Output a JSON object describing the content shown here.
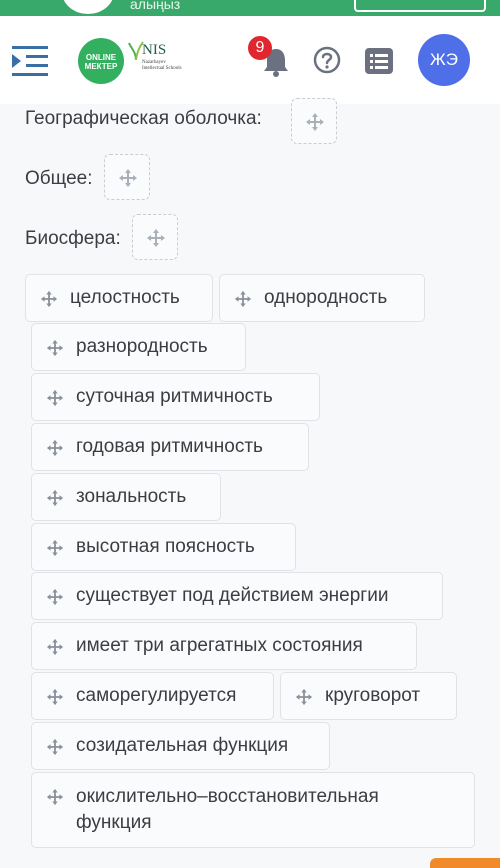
{
  "top_strip": {
    "text": "алыңыз"
  },
  "header": {
    "logo_online_text": "ONLINE\nМЕКТЕР",
    "logo_nis_text": "NIS",
    "logo_nis_sub": "Nazarbayev Intellectual Schools",
    "notification_count": "9",
    "avatar_initials": "ЖЭ"
  },
  "targets": [
    {
      "label": "Географическая оболочка:"
    },
    {
      "label": "Общее:"
    },
    {
      "label": "Биосфера:"
    }
  ],
  "options": [
    {
      "label": "целостность"
    },
    {
      "label": "однородность"
    },
    {
      "label": "разнородность"
    },
    {
      "label": "суточная ритмичность"
    },
    {
      "label": "годовая ритмичность"
    },
    {
      "label": "зональность"
    },
    {
      "label": "высотная поясность"
    },
    {
      "label": "существует под действием энергии"
    },
    {
      "label": "имеет три агрегатных состояния"
    },
    {
      "label": "саморегулируется"
    },
    {
      "label": "круговорот"
    },
    {
      "label": "созидательная функция"
    },
    {
      "label": "окислительно–восстановительная функция"
    }
  ],
  "colors": {
    "brand_green": "#33b05f",
    "avatar_blue": "#4f6fe8",
    "badge_red": "#e0262e",
    "icon_gray": "#6b7180"
  },
  "icons": [
    "menu-collapse-icon",
    "bell-icon",
    "help-circle-icon",
    "list-icon",
    "move-icon"
  ]
}
